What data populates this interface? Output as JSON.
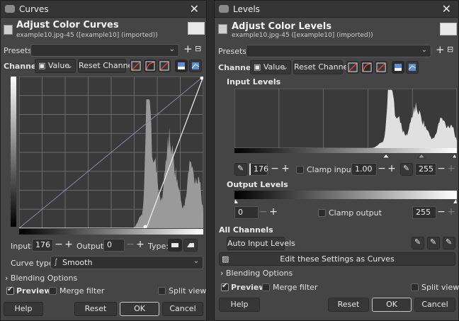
{
  "curves": {
    "title": "Curves",
    "header_title": "Adjust Color Curves",
    "header_sub": "example10.jpg-45 ([example10] (imported))",
    "presets_label": "Presets:",
    "channel_label": "Channel:",
    "channel_value": "Value",
    "reset_channel": "Reset Channel",
    "input_label": "Input:",
    "input_value": "176",
    "output_label": "Output:",
    "output_value": "0",
    "type_label": "Type:",
    "curve_type_label": "Curve type:",
    "curve_type_value": "Smooth",
    "blending": "Blending Options",
    "preview": "Preview",
    "merge_filter": "Merge filter",
    "split_view": "Split view",
    "help": "Help",
    "reset": "Reset",
    "ok": "OK",
    "cancel": "Cancel",
    "curve_points": [
      [
        0,
        0
      ],
      [
        176,
        0
      ],
      [
        255,
        255
      ]
    ]
  },
  "levels": {
    "title": "Levels",
    "header_title": "Adjust Color Levels",
    "header_sub": "example10.jpg-45 ([example10] (imported))",
    "presets_label": "Presets:",
    "channel_label": "Channel:",
    "channel_value": "Value",
    "reset_channel": "Reset Channel",
    "input_levels": "Input Levels",
    "input_low": "176",
    "clamp_input": "Clamp input",
    "gamma": "1.00",
    "input_high": "255",
    "output_levels": "Output Levels",
    "output_low": "0",
    "clamp_output": "Clamp output",
    "output_high": "255",
    "all_channels": "All Channels",
    "auto_input_levels": "Auto Input Levels",
    "edit_as_curves": "Edit these Settings as Curves",
    "blending": "Blending Options",
    "preview": "Preview",
    "merge_filter": "Merge filter",
    "split_view": "Split view",
    "help": "Help",
    "reset": "Reset",
    "ok": "OK",
    "cancel": "Cancel"
  }
}
